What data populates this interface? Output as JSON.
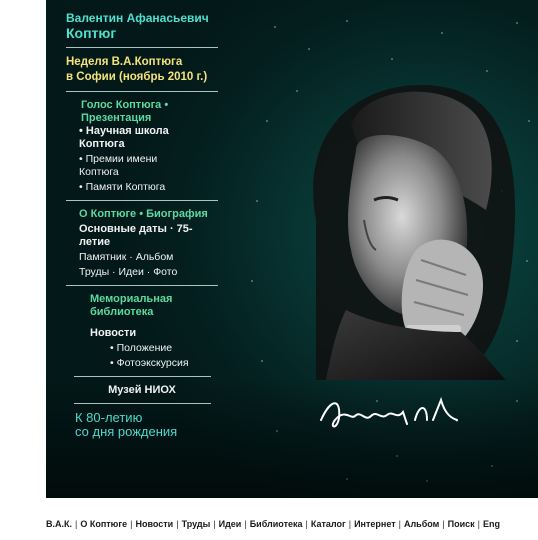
{
  "sidebar": {
    "name_line1": "Валентин Афанасьевич",
    "name_line2": "Коптюг",
    "week_line1": "Неделя В.А.Коптюга",
    "week_line2": "в Софии (ноябрь 2010 г.)",
    "voice": "Голос Коптюга",
    "presentation": "Презентация",
    "sci_school_line1": "• Научная школа",
    "sci_school_line2": "Коптюга",
    "prizes_line1": "• Премии имени",
    "prizes_line2": "Коптюга",
    "memory": "• Памяти Коптюга",
    "about": "О Коптюге",
    "biography": "Биография",
    "dates_line1": "Основные даты · 75-",
    "dates_line2": "летие",
    "monument": "Памятник",
    "album": "Альбом",
    "works": "Труды",
    "ideas": "Идеи",
    "photo": "Фото",
    "library_line1": "Мемориальная",
    "library_line2": "библиотека",
    "news": "Новости",
    "regulation": "• Положение",
    "photo_tour": "• Фотоэкскурсия",
    "museum": "Музей НИОХ",
    "anniv_line1": "К 80-летию",
    "anniv_line2": "со дня рождения"
  },
  "footer": {
    "items": [
      "В.А.К.",
      "О Коптюге",
      "Новости",
      "Труды",
      "Идеи",
      "Библиотека",
      "Каталог",
      "Интернет",
      "Альбом",
      "Поиск",
      "Eng"
    ]
  },
  "colors": {
    "background": "#07312f",
    "name": "#4fe0cf",
    "highlight": "#f4e27a",
    "green_links": "#5cd9a0"
  }
}
